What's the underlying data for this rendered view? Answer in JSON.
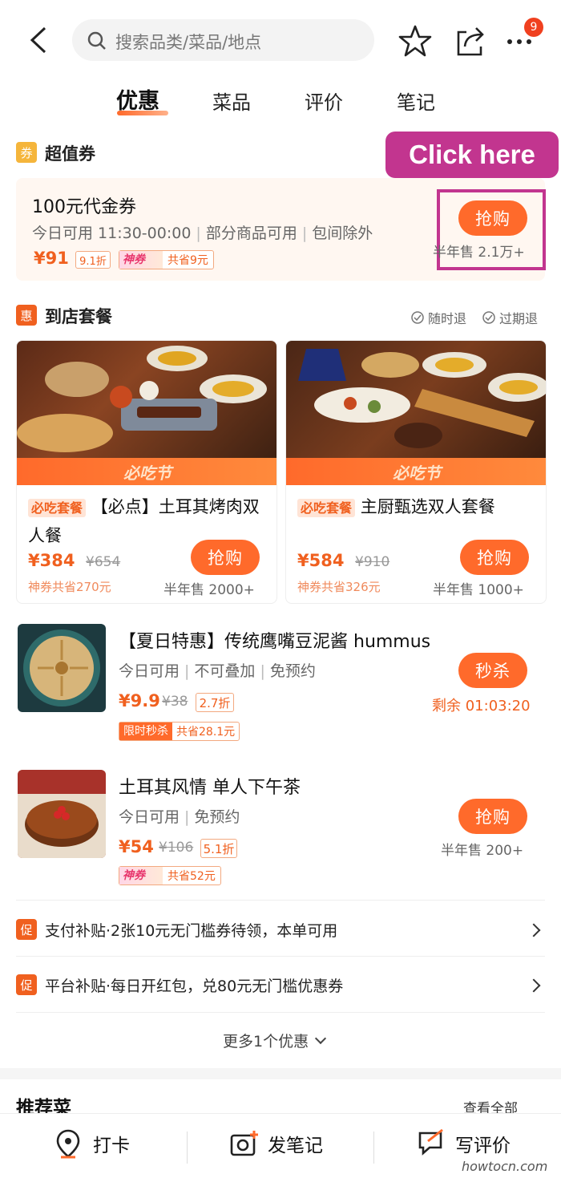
{
  "header": {
    "search_placeholder": "搜索品类/菜品/地点",
    "badge": "9"
  },
  "tabs": [
    {
      "label": "优惠"
    },
    {
      "label": "菜品"
    },
    {
      "label": "评价"
    },
    {
      "label": "笔记"
    }
  ],
  "coupon_section": {
    "icon": "券",
    "title": "超值券",
    "callout": "Click here"
  },
  "coupon": {
    "title": "100元代金券",
    "meta1": "今日可用 11:30-00:00",
    "meta2": "部分商品可用",
    "meta3": "包间除外",
    "price": "¥91",
    "discount": "9.1折",
    "shen_tag": "神券",
    "save": "共省9元",
    "button": "抢购",
    "sold": "半年售 2.1万+"
  },
  "package_section": {
    "icon": "惠",
    "title": "到店套餐",
    "refund1": "随时退",
    "refund2": "过期退"
  },
  "packages": [
    {
      "banner": "必吃节",
      "tag": "必吃套餐",
      "title": "【必点】土耳其烤肉双人餐",
      "price": "¥384",
      "orig": "¥654",
      "save": "神券共省270元",
      "button": "抢购",
      "sold": "半年售 2000+"
    },
    {
      "banner": "必吃节",
      "tag": "必吃套餐",
      "title": "主厨甄选双人套餐",
      "price": "¥584",
      "orig": "¥910",
      "save": "神券共省326元",
      "button": "抢购",
      "sold": "半年售 1000+"
    }
  ],
  "deals": [
    {
      "title": "【夏日特惠】传统鹰嘴豆泥酱 hummus",
      "meta1": "今日可用",
      "meta2": "不可叠加",
      "meta3": "免预约",
      "price": "¥9.9",
      "orig": "¥38",
      "discount": "2.7折",
      "tag1": "限时秒杀",
      "tag2": "共省28.1元",
      "button": "秒杀",
      "sold": "剩余 01:03:20"
    },
    {
      "title": "土耳其风情 单人下午茶",
      "meta1": "今日可用",
      "meta2": "免预约",
      "price": "¥54",
      "orig": "¥106",
      "discount": "5.1折",
      "tag1": "神券",
      "tag2": "共省52元",
      "button": "抢购",
      "sold": "半年售 200+"
    }
  ],
  "promos": [
    {
      "icon": "促",
      "text": "支付补贴·2张10元无门槛券待领，本单可用"
    },
    {
      "icon": "促",
      "text": "平台补贴·每日开红包，兑80元无门槛优惠券"
    }
  ],
  "more": "更多1个优惠",
  "recommend": {
    "title": "推荐菜",
    "link": "查看全部"
  },
  "bottom": {
    "checkin": "打卡",
    "note": "发笔记",
    "review": "写评价"
  },
  "watermark": "howtocn.com",
  "colors": {
    "accent": "#ff6a2b",
    "callout": "#c2358f"
  }
}
